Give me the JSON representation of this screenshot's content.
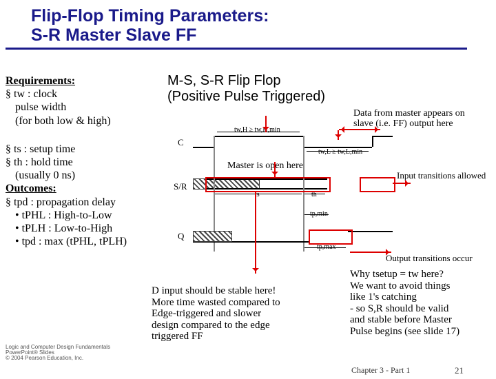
{
  "title_l1": "Flip-Flop Timing Parameters:",
  "title_l2": "S-R Master Slave FF",
  "req_head": "Requirements:",
  "tw_l1": "tw : clock",
  "tw_l2": "pulse width",
  "tw_l3": "(for both low & high)",
  "ts": "ts : setup time",
  "th": "th : hold time",
  "th_note": "(usually 0 ns)",
  "out_head": "Outcomes:",
  "tpd": "tpd : propagation delay",
  "tphl": "tPHL : High-to-Low",
  "tplh": "tPLH : Low-to-High",
  "tpdmax": "tpd : max (tPHL, tPLH)",
  "ff_l1": "M-S, S-R Flip Flop",
  "ff_l2": "(Positive Pulse Triggered)",
  "note_data_l1": "Data from master appears on",
  "note_data_l2": "slave (i.e. FF) output here",
  "note_master": "Master is open here",
  "note_input": "Input transitions allowed",
  "note_output": "Output transitions occur",
  "why_l1": "Why tsetup = tw here?",
  "why_l2": "We want to avoid things",
  "why_l3": "like 1's catching",
  "why_l4": "- so S,R should be valid",
  "why_l5": "and stable before Master",
  "why_l6": "Pulse begins (see slide 17)",
  "din_l1": "D input should be stable here!",
  "din_l2": "More time wasted compared to",
  "din_l3": "Edge-triggered and slower",
  "din_l4": "design compared to the edge",
  "din_l5": "triggered FF",
  "sig_c": "C",
  "sig_sr": "S/R",
  "sig_q": "Q",
  "lab_twh": "tw,H ≥ tw,H,min",
  "lab_twl": "tw,L ≥ tw,L,min",
  "lab_ts": "ts",
  "lab_th": "th",
  "lab_tpmin": "tp,min",
  "lab_tpmax": "tp,max",
  "pearson_l1": "Logic and Computer Design Fundamentals",
  "pearson_l2": "PowerPoint® Slides",
  "pearson_l3": "© 2004 Pearson Education, Inc.",
  "footer": "Chapter 3 - Part 1",
  "pagenum": "21"
}
